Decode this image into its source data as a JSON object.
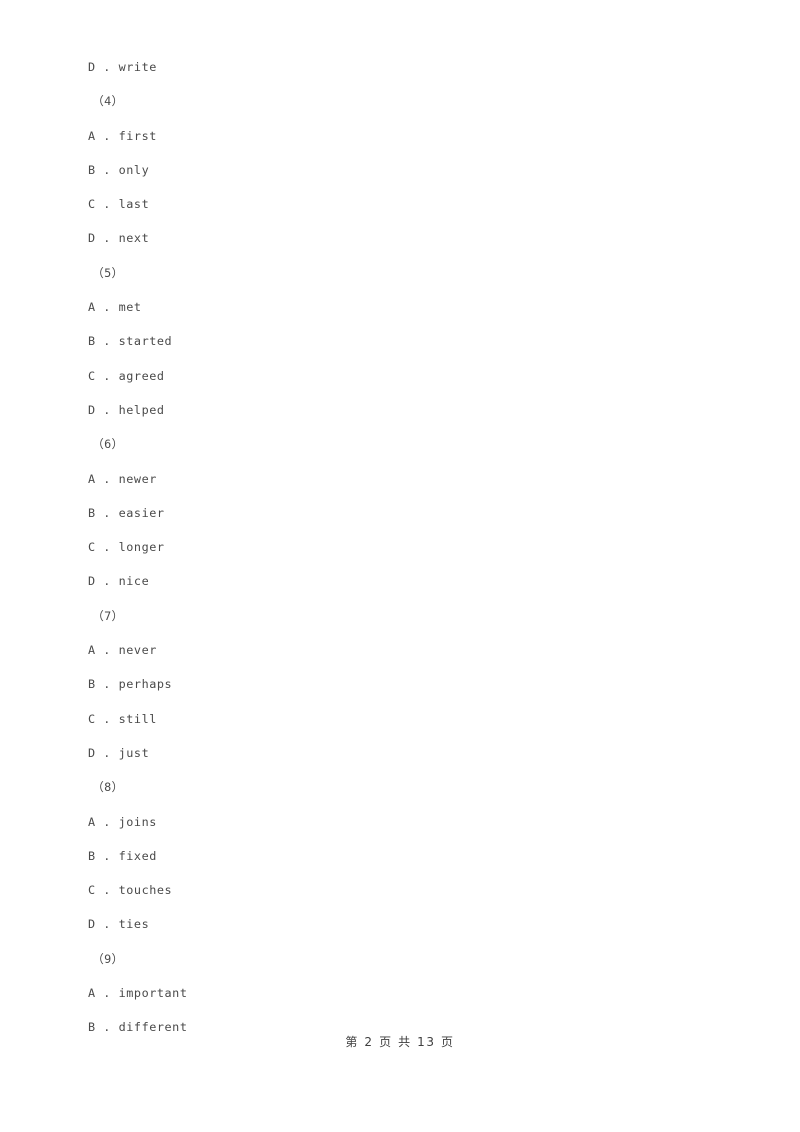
{
  "document": {
    "background_color": "#ffffff",
    "text_color": "#4a4a4a",
    "lines": [
      {
        "type": "option",
        "text": "D . write"
      },
      {
        "type": "qnum",
        "text": "（4）"
      },
      {
        "type": "option",
        "text": "A . first"
      },
      {
        "type": "option",
        "text": "B . only"
      },
      {
        "type": "option",
        "text": "C . last"
      },
      {
        "type": "option",
        "text": "D . next"
      },
      {
        "type": "qnum",
        "text": "（5）"
      },
      {
        "type": "option",
        "text": "A . met"
      },
      {
        "type": "option",
        "text": "B . started"
      },
      {
        "type": "option",
        "text": "C . agreed"
      },
      {
        "type": "option",
        "text": "D . helped"
      },
      {
        "type": "qnum",
        "text": "（6）"
      },
      {
        "type": "option",
        "text": "A . newer"
      },
      {
        "type": "option",
        "text": "B . easier"
      },
      {
        "type": "option",
        "text": "C . longer"
      },
      {
        "type": "option",
        "text": "D . nice"
      },
      {
        "type": "qnum",
        "text": "（7）"
      },
      {
        "type": "option",
        "text": "A . never"
      },
      {
        "type": "option",
        "text": "B . perhaps"
      },
      {
        "type": "option",
        "text": "C . still"
      },
      {
        "type": "option",
        "text": "D . just"
      },
      {
        "type": "qnum",
        "text": "（8）"
      },
      {
        "type": "option",
        "text": "A . joins"
      },
      {
        "type": "option",
        "text": "B . fixed"
      },
      {
        "type": "option",
        "text": "C . touches"
      },
      {
        "type": "option",
        "text": "D . ties"
      },
      {
        "type": "qnum",
        "text": "（9）"
      },
      {
        "type": "option",
        "text": "A . important"
      },
      {
        "type": "option",
        "text": "B . different"
      }
    ]
  },
  "footer": {
    "text": "第 2 页 共 13 页",
    "current_page": "2",
    "total_pages": "13"
  }
}
